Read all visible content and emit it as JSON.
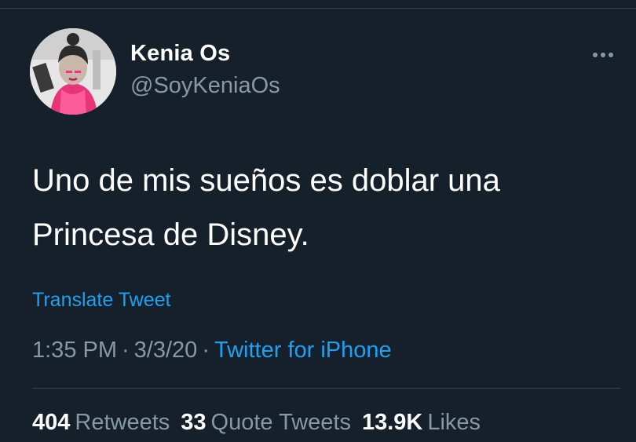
{
  "tweet": {
    "author": {
      "display_name": "Kenia Os",
      "handle": "@SoyKeniaOs"
    },
    "text_line_1": "Uno de mis sueños es doblar una",
    "text_line_2": "Princesa de Disney.",
    "translate_label": "Translate Tweet",
    "time": "1:35 PM",
    "date": "3/3/20",
    "separator": "·",
    "source": "Twitter for iPhone",
    "stats": {
      "retweets_count": "404",
      "retweets_label": "Retweets",
      "quote_count": "33",
      "quote_label": "Quote Tweets",
      "likes_count": "13.9K",
      "likes_label": "Likes"
    }
  },
  "icons": {
    "more": "more-horizontal-icon"
  },
  "colors": {
    "background": "#15202b",
    "divider": "#38444d",
    "primary_text": "#ffffff",
    "secondary_text": "#8899a6",
    "accent": "#1da1f2"
  }
}
